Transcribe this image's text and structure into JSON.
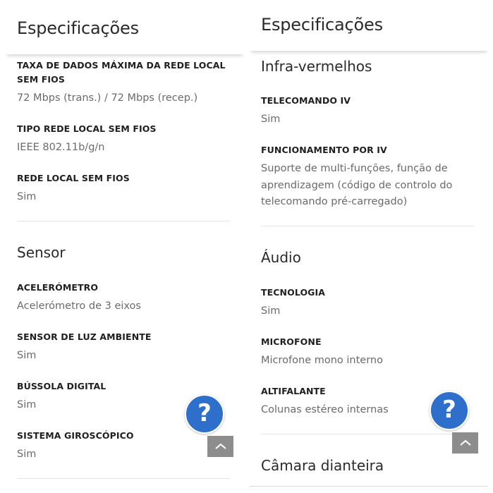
{
  "left": {
    "header_title": "Especificações",
    "wlan_max": {
      "label_line1": "TAXA DE DADOS MÁXIMA DA REDE LOCAL",
      "label_line2": "SEM FIOS",
      "value": "72 Mbps (trans.) / 72 Mbps (recep.)"
    },
    "wlan_type": {
      "label": "TIPO REDE LOCAL SEM FIOS",
      "value": "IEEE 802.11b/g/n"
    },
    "wlan": {
      "label": "REDE LOCAL SEM FIOS",
      "value": "Sim"
    },
    "sensor_section": "Sensor",
    "accelerometer": {
      "label": "ACELERÓMETRO",
      "value": "Acelerómetro de 3 eixos"
    },
    "light_sensor": {
      "label": "SENSOR DE LUZ AMBIENTE",
      "value": "Sim"
    },
    "compass": {
      "label": "BÚSSOLA DIGITAL",
      "value": "Sim"
    },
    "gyroscope": {
      "label": "SISTEMA GIROSCÓPICO",
      "value": "Sim"
    },
    "help_glyph": "?"
  },
  "right": {
    "header_title": "Especificações",
    "infrared_section": "Infra-vermelhos",
    "ir_remote": {
      "label": "TELECOMANDO IV",
      "value": "Sim"
    },
    "ir_function": {
      "label": "FUNCIONAMENTO POR IV",
      "value_line1": "Suporte de multi-funções, função de",
      "value_line2": "aprendizagem (código de controlo do",
      "value_line3": "telecomando pré-carregado)"
    },
    "audio_section": "Áudio",
    "technology": {
      "label": "TECNOLOGIA",
      "value": "Sim"
    },
    "microphone": {
      "label": "MICROFONE",
      "value": "Microfone mono interno"
    },
    "speaker": {
      "label": "ALTIFALANTE",
      "value": "Colunas estéreo internas"
    },
    "front_camera_section": "Câmara dianteira",
    "help_glyph": "?"
  },
  "colors": {
    "accent": "#2d6fcb",
    "scroll_button": "#8d8d8d",
    "label": "#1f1f1f",
    "value": "#6a6a6a"
  },
  "icons": {
    "help": "question-mark-icon",
    "scroll_top": "chevron-up-icon"
  }
}
